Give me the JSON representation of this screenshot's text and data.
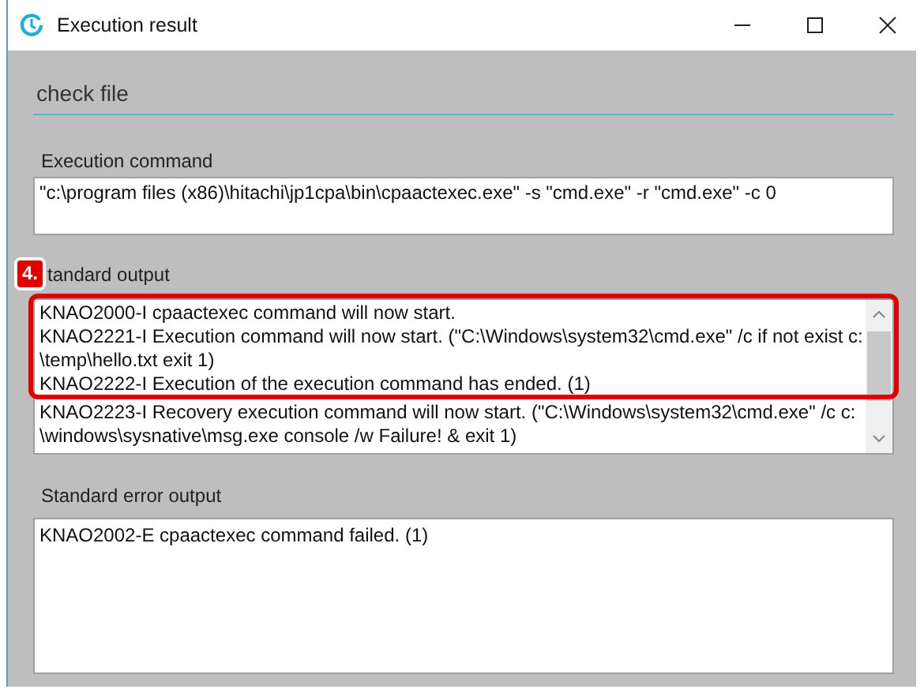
{
  "window": {
    "title": "Execution result"
  },
  "task_name": "check file",
  "execution_command": {
    "label": "Execution command",
    "value": "\"c:\\program files (x86)\\hitachi\\jp1cpa\\bin\\cpaactexec.exe\" -s \"cmd.exe\" -r \"cmd.exe\" -c 0"
  },
  "standard_output": {
    "label": "tandard output",
    "badge": "4.",
    "highlighted_lines": [
      "KNAO2000-I cpaactexec command will now start.",
      "KNAO2221-I Execution command will now start. (\"C:\\Windows\\system32\\cmd.exe\" /c if not exist c:",
      "\\temp\\hello.txt exit 1)",
      "KNAO2222-I Execution of the execution command has ended. (1)"
    ],
    "other_lines": [
      "KNAO2223-I Recovery execution command will now start. (\"C:\\Windows\\system32\\cmd.exe\" /c c:",
      "\\windows\\sysnative\\msg.exe console /w Failure! & exit 1)"
    ]
  },
  "standard_error_output": {
    "label": "Standard error output",
    "lines": [
      "KNAO2002-E cpaactexec command failed. (1)"
    ]
  }
}
